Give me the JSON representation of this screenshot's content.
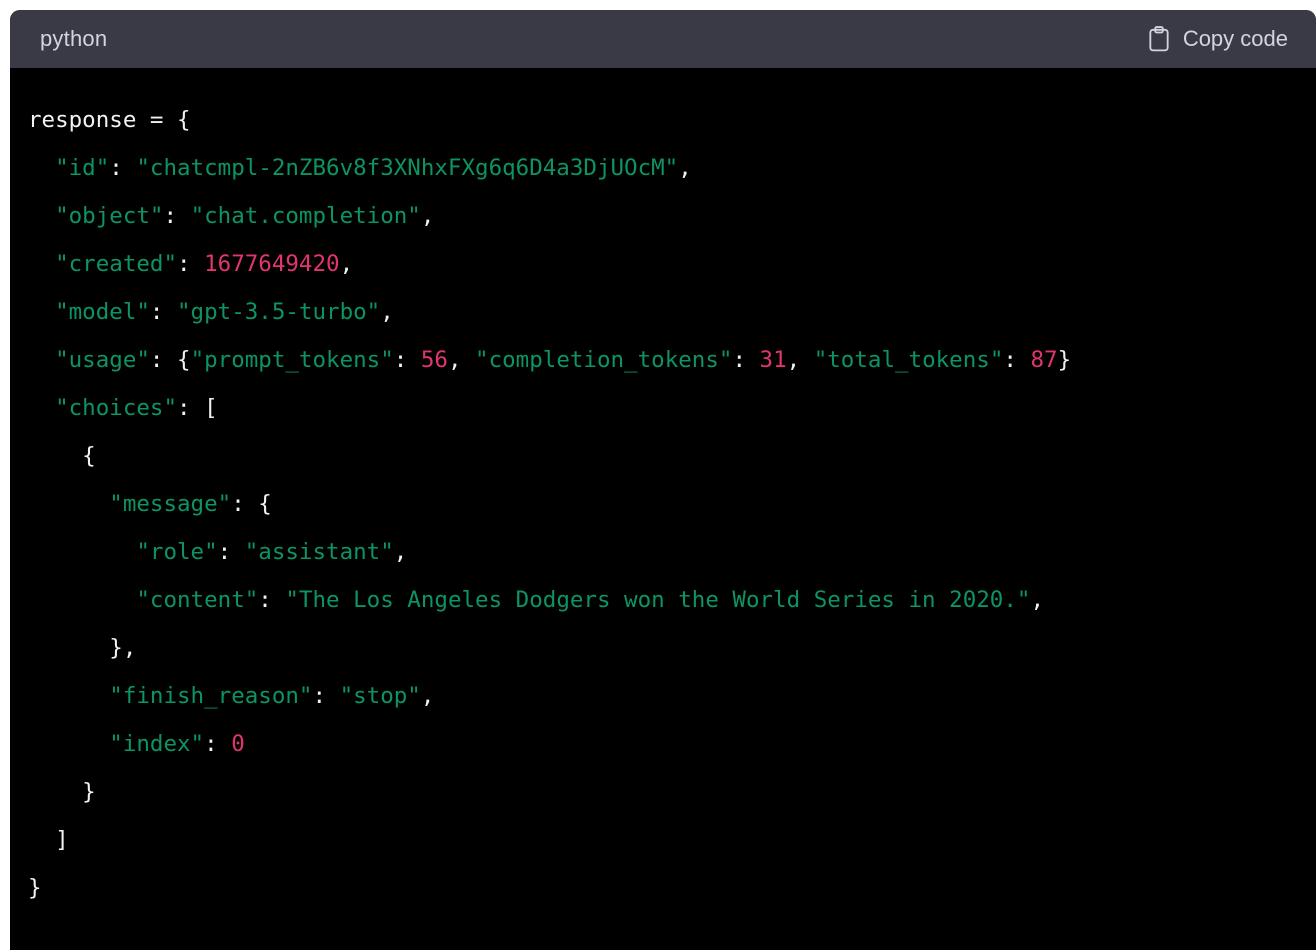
{
  "window": {
    "page_background": "#ffffff"
  },
  "code_block": {
    "header": {
      "language_label": "python",
      "copy_button_label": "Copy code",
      "copy_icon": "clipboard-icon",
      "background_color": "#393a46",
      "text_color": "#d4d4dc"
    },
    "body": {
      "background_color": "#000000",
      "theme": {
        "plain_color": "#f2f2f2",
        "string_color": "#0c9463",
        "number_color": "#e1356e",
        "punctuation_color": "#f2f2f2"
      },
      "language": "python",
      "code_text": "response = {\n  \"id\": \"chatcmpl-2nZB6v8f3XNhxFXg6q6D4a3DjUOcM\",\n  \"object\": \"chat.completion\",\n  \"created\": 1677649420,\n  \"model\": \"gpt-3.5-turbo\",\n  \"usage\": {\"prompt_tokens\": 56, \"completion_tokens\": 31, \"total_tokens\": 87},\n  \"choices\": [\n    {\n      \"message\": {\n        \"role\": \"assistant\",\n        \"content\": \"The Los Angeles Dodgers won the World Series in 2020.\",\n      },\n      \"finish_reason\": \"stop\",\n      \"index\": 0\n    }\n  ]\n}",
      "lines": [
        {
          "n": 1,
          "tokens": [
            {
              "t": "response = {",
              "k": "plain"
            }
          ]
        },
        {
          "n": 2,
          "tokens": [
            {
              "t": "  ",
              "k": "plain"
            },
            {
              "t": "\"id\"",
              "k": "string"
            },
            {
              "t": ": ",
              "k": "punct"
            },
            {
              "t": "\"chatcmpl-2nZB6v8f3XNhxFXg6q6D4a3DjUOcM\"",
              "k": "string"
            },
            {
              "t": ",",
              "k": "punct"
            }
          ]
        },
        {
          "n": 3,
          "tokens": [
            {
              "t": "  ",
              "k": "plain"
            },
            {
              "t": "\"object\"",
              "k": "string"
            },
            {
              "t": ": ",
              "k": "punct"
            },
            {
              "t": "\"chat.completion\"",
              "k": "string"
            },
            {
              "t": ",",
              "k": "punct"
            }
          ]
        },
        {
          "n": 4,
          "tokens": [
            {
              "t": "  ",
              "k": "plain"
            },
            {
              "t": "\"created\"",
              "k": "string"
            },
            {
              "t": ": ",
              "k": "punct"
            },
            {
              "t": "1677649420",
              "k": "number"
            },
            {
              "t": ",",
              "k": "punct"
            }
          ]
        },
        {
          "n": 5,
          "tokens": [
            {
              "t": "  ",
              "k": "plain"
            },
            {
              "t": "\"model\"",
              "k": "string"
            },
            {
              "t": ": ",
              "k": "punct"
            },
            {
              "t": "\"gpt-3.5-turbo\"",
              "k": "string"
            },
            {
              "t": ",",
              "k": "punct"
            }
          ]
        },
        {
          "n": 6,
          "tokens": [
            {
              "t": "  ",
              "k": "plain"
            },
            {
              "t": "\"usage\"",
              "k": "string"
            },
            {
              "t": ": {",
              "k": "punct"
            },
            {
              "t": "\"prompt_tokens\"",
              "k": "string"
            },
            {
              "t": ": ",
              "k": "punct"
            },
            {
              "t": "56",
              "k": "number"
            },
            {
              "t": ", ",
              "k": "punct"
            },
            {
              "t": "\"completion_tokens\"",
              "k": "string"
            },
            {
              "t": ": ",
              "k": "punct"
            },
            {
              "t": "31",
              "k": "number"
            },
            {
              "t": ", ",
              "k": "punct"
            },
            {
              "t": "\"total_tokens\"",
              "k": "string"
            },
            {
              "t": ": ",
              "k": "punct"
            },
            {
              "t": "87",
              "k": "number"
            },
            {
              "t": "}",
              "k": "punct"
            }
          ]
        },
        {
          "n": 7,
          "tokens": [
            {
              "t": "  ",
              "k": "plain"
            },
            {
              "t": "\"choices\"",
              "k": "string"
            },
            {
              "t": ": [",
              "k": "punct"
            }
          ]
        },
        {
          "n": 8,
          "tokens": [
            {
              "t": "    {",
              "k": "punct"
            }
          ]
        },
        {
          "n": 9,
          "tokens": [
            {
              "t": "      ",
              "k": "plain"
            },
            {
              "t": "\"message\"",
              "k": "string"
            },
            {
              "t": ": {",
              "k": "punct"
            }
          ]
        },
        {
          "n": 10,
          "tokens": [
            {
              "t": "        ",
              "k": "plain"
            },
            {
              "t": "\"role\"",
              "k": "string"
            },
            {
              "t": ": ",
              "k": "punct"
            },
            {
              "t": "\"assistant\"",
              "k": "string"
            },
            {
              "t": ",",
              "k": "punct"
            }
          ]
        },
        {
          "n": 11,
          "tokens": [
            {
              "t": "        ",
              "k": "plain"
            },
            {
              "t": "\"content\"",
              "k": "string"
            },
            {
              "t": ": ",
              "k": "punct"
            },
            {
              "t": "\"The Los Angeles Dodgers won the World Series in 2020.\"",
              "k": "string"
            },
            {
              "t": ",",
              "k": "punct"
            }
          ]
        },
        {
          "n": 12,
          "tokens": [
            {
              "t": "      },",
              "k": "punct"
            }
          ]
        },
        {
          "n": 13,
          "tokens": [
            {
              "t": "      ",
              "k": "plain"
            },
            {
              "t": "\"finish_reason\"",
              "k": "string"
            },
            {
              "t": ": ",
              "k": "punct"
            },
            {
              "t": "\"stop\"",
              "k": "string"
            },
            {
              "t": ",",
              "k": "punct"
            }
          ]
        },
        {
          "n": 14,
          "tokens": [
            {
              "t": "      ",
              "k": "plain"
            },
            {
              "t": "\"index\"",
              "k": "string"
            },
            {
              "t": ": ",
              "k": "punct"
            },
            {
              "t": "0",
              "k": "number"
            }
          ]
        },
        {
          "n": 15,
          "tokens": [
            {
              "t": "    }",
              "k": "punct"
            }
          ]
        },
        {
          "n": 16,
          "tokens": [
            {
              "t": "  ]",
              "k": "punct"
            }
          ]
        },
        {
          "n": 17,
          "tokens": [
            {
              "t": "}",
              "k": "punct"
            }
          ]
        }
      ]
    }
  }
}
